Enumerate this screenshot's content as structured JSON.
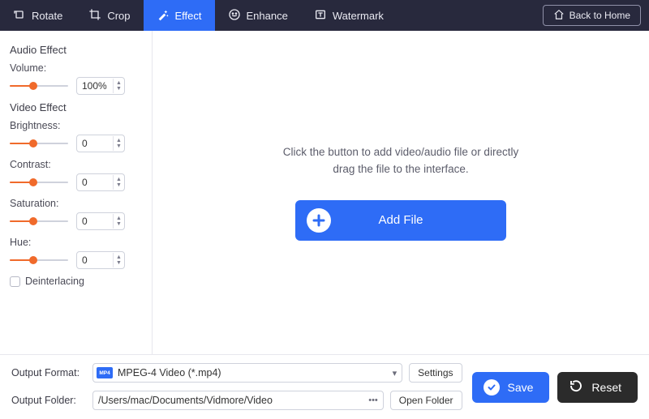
{
  "topbar": {
    "tabs": [
      {
        "id": "rotate",
        "label": "Rotate",
        "active": false
      },
      {
        "id": "crop",
        "label": "Crop",
        "active": false
      },
      {
        "id": "effect",
        "label": "Effect",
        "active": true
      },
      {
        "id": "enhance",
        "label": "Enhance",
        "active": false
      },
      {
        "id": "watermark",
        "label": "Watermark",
        "active": false
      }
    ],
    "back_to_home": "Back to Home"
  },
  "sidebar": {
    "audio_effect_title": "Audio Effect",
    "volume_label": "Volume:",
    "volume_value": "100%",
    "volume_fill_pct": 40,
    "video_effect_title": "Video Effect",
    "controls": [
      {
        "id": "brightness",
        "label": "Brightness:",
        "value": "0",
        "fill_pct": 40
      },
      {
        "id": "contrast",
        "label": "Contrast:",
        "value": "0",
        "fill_pct": 40
      },
      {
        "id": "saturation",
        "label": "Saturation:",
        "value": "0",
        "fill_pct": 40
      },
      {
        "id": "hue",
        "label": "Hue:",
        "value": "0",
        "fill_pct": 40
      }
    ],
    "deinterlacing_label": "Deinterlacing",
    "deinterlacing_checked": false
  },
  "canvas": {
    "hint_line1": "Click the button to add video/audio file or directly",
    "hint_line2": "drag the file to the interface.",
    "add_file_label": "Add File"
  },
  "bottom": {
    "output_format_label": "Output Format:",
    "output_format_value": "MPEG-4 Video (*.mp4)",
    "settings_label": "Settings",
    "output_folder_label": "Output Folder:",
    "output_folder_value": "/Users/mac/Documents/Vidmore/Video",
    "open_folder_label": "Open Folder",
    "save_label": "Save",
    "reset_label": "Reset"
  }
}
